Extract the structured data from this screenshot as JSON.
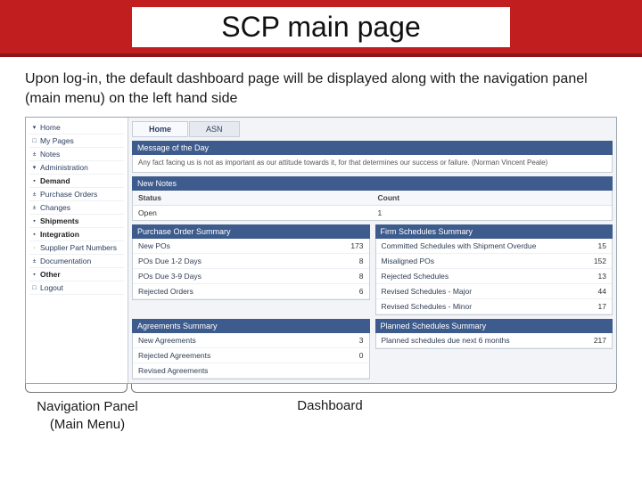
{
  "slide": {
    "title": "SCP main page",
    "intro": "Upon log-in, the default dashboard page will be displayed along with the navigation panel (main menu) on the left hand side",
    "label_nav": "Navigation Panel (Main Menu)",
    "label_dash": "Dashboard"
  },
  "nav": {
    "items": [
      {
        "tw": "▾",
        "label": "Home"
      },
      {
        "tw": "□",
        "label": "My Pages"
      },
      {
        "tw": "±",
        "label": "Notes"
      },
      {
        "tw": "▾",
        "label": "Administration"
      },
      {
        "tw": "▪",
        "label": "Demand",
        "bold": true
      },
      {
        "tw": "±",
        "label": "Purchase Orders"
      },
      {
        "tw": "±",
        "label": "Changes"
      },
      {
        "tw": "▪",
        "label": "Shipments",
        "bold": true
      },
      {
        "tw": "▪",
        "label": "Integration",
        "bold": true
      },
      {
        "tw": "·",
        "label": "Supplier Part Numbers"
      },
      {
        "tw": "±",
        "label": "Documentation"
      },
      {
        "tw": "▪",
        "label": "Other",
        "bold": true
      },
      {
        "tw": "□",
        "label": "Logout"
      }
    ]
  },
  "tabs": {
    "home": "Home",
    "asn": "ASN"
  },
  "motd": {
    "header": "Message of the Day",
    "text": "Any fact facing us is not as important as our attitude towards it, for that determines our success or failure. (Norman Vincent Peale)"
  },
  "notes": {
    "header": "New Notes",
    "col_status": "Status",
    "col_count": "Count",
    "status": "Open",
    "count": "1"
  },
  "po": {
    "header": "Purchase Order Summary",
    "rows": [
      {
        "label": "New POs",
        "val": "173"
      },
      {
        "label": "POs Due 1-2 Days",
        "val": "8"
      },
      {
        "label": "POs Due 3-9 Days",
        "val": "8"
      },
      {
        "label": "Rejected Orders",
        "val": "6"
      }
    ]
  },
  "firm": {
    "header": "Firm Schedules Summary",
    "rows": [
      {
        "label": "Committed Schedules with Shipment Overdue",
        "val": "15"
      },
      {
        "label": "Misaligned POs",
        "val": "152"
      },
      {
        "label": "Rejected Schedules",
        "val": "13"
      },
      {
        "label": "Revised Schedules - Major",
        "val": "44"
      },
      {
        "label": "Revised Schedules - Minor",
        "val": "17"
      }
    ]
  },
  "agr": {
    "header": "Agreements Summary",
    "rows": [
      {
        "label": "New Agreements",
        "val": "3"
      },
      {
        "label": "Rejected Agreements",
        "val": "0"
      },
      {
        "label": "Revised Agreements",
        "val": ""
      }
    ]
  },
  "plan": {
    "header": "Planned Schedules Summary",
    "rows": [
      {
        "label": "Planned schedules due next 6 months",
        "val": "217"
      }
    ]
  }
}
